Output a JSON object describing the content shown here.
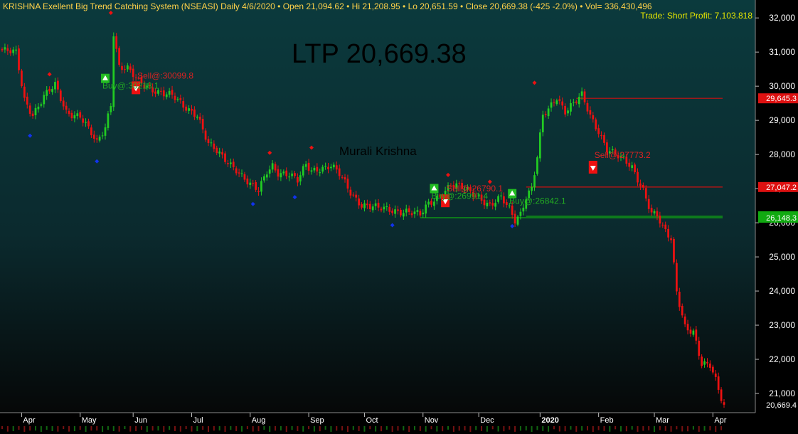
{
  "header": {
    "title_line": "KRISHNA Exellent Big Trend Catching System (NSEASI) Daily  4/6/2020  •  Open 21,094.62  •  Hi 21,208.95  •  Lo 20,651.59  •  Close 20,669.38 (-425 -2.0%)  •  Vol= 336,430,496",
    "trade_status": "Trade: Short Profit: 7,103.818",
    "ltp_label": "LTP 20,669.38",
    "watermark": "Murali Krishna"
  },
  "colors": {
    "bull": "#22cc22",
    "bear": "#ee1111",
    "buy_text": "#22aa22",
    "sell_text": "#dd2222",
    "title_text": "#ffd24a",
    "trade_text": "#e6e600",
    "axis_text": "#ffffff",
    "resist_line": "#cc1111",
    "support_line": "#11aa11",
    "swing_low_dot": "#1133ee",
    "swing_high_dot": "#ee1111"
  },
  "chart_data": {
    "type": "candlestick",
    "symbol": "NSEASI",
    "ylim": [
      20500,
      32400
    ],
    "y_ticks": [
      21000,
      22000,
      23000,
      24000,
      25000,
      26000,
      27000,
      28000,
      29000,
      30000,
      31000,
      32000
    ],
    "y_tick_labels": [
      "21,000",
      "22,000",
      "23,000",
      "24,000",
      "25,000",
      "26,000",
      "27,000",
      "28,000",
      "29,000",
      "30,000",
      "31,000",
      "32,000"
    ],
    "x_labels": [
      "Apr",
      "May",
      "Jun",
      "Jul",
      "Aug",
      "Sep",
      "Oct",
      "Nov",
      "Dec",
      "2020",
      "Feb",
      "Mar",
      "Apr"
    ],
    "x_label_index": [
      7,
      28,
      47,
      68,
      89,
      110,
      130,
      151,
      171,
      193,
      214,
      234,
      255
    ],
    "bar_count": 260,
    "close_anchors": [
      [
        0,
        31050
      ],
      [
        5,
        30950
      ],
      [
        8,
        29600
      ],
      [
        11,
        29200
      ],
      [
        15,
        29700
      ],
      [
        19,
        30000
      ],
      [
        23,
        29250
      ],
      [
        28,
        29150
      ],
      [
        34,
        28300
      ],
      [
        37,
        28800
      ],
      [
        39,
        29500
      ],
      [
        40,
        31600
      ],
      [
        42,
        30600
      ],
      [
        45,
        30500
      ],
      [
        49,
        30100
      ],
      [
        55,
        29900
      ],
      [
        61,
        29700
      ],
      [
        65,
        29400
      ],
      [
        70,
        29200
      ],
      [
        74,
        28300
      ],
      [
        79,
        27900
      ],
      [
        84,
        27600
      ],
      [
        89,
        27100
      ],
      [
        92,
        26900
      ],
      [
        95,
        27500
      ],
      [
        97,
        27700
      ],
      [
        99,
        27500
      ],
      [
        103,
        27400
      ],
      [
        106,
        27200
      ],
      [
        109,
        27700
      ],
      [
        111,
        27550
      ],
      [
        113,
        27600
      ],
      [
        118,
        27650
      ],
      [
        121,
        27400
      ],
      [
        125,
        26900
      ],
      [
        129,
        26550
      ],
      [
        135,
        26400
      ],
      [
        145,
        26350
      ],
      [
        150,
        26200
      ],
      [
        153,
        26550
      ],
      [
        158,
        26900
      ],
      [
        161,
        27100
      ],
      [
        165,
        27000
      ],
      [
        171,
        26800
      ],
      [
        175,
        26500
      ],
      [
        179,
        26700
      ],
      [
        182,
        26400
      ],
      [
        184,
        26100
      ],
      [
        186,
        26300
      ],
      [
        188,
        26800
      ],
      [
        190,
        27000
      ],
      [
        192,
        27900
      ],
      [
        194,
        29100
      ],
      [
        196,
        29300
      ],
      [
        199,
        29700
      ],
      [
        202,
        29300
      ],
      [
        205,
        29500
      ],
      [
        208,
        29700
      ],
      [
        211,
        29100
      ],
      [
        214,
        28700
      ],
      [
        217,
        28200
      ],
      [
        220,
        28000
      ],
      [
        223,
        27800
      ],
      [
        226,
        27600
      ],
      [
        230,
        27000
      ],
      [
        233,
        26300
      ],
      [
        235,
        26200
      ],
      [
        237,
        25800
      ],
      [
        240,
        25500
      ],
      [
        242,
        24000
      ],
      [
        245,
        23000
      ],
      [
        248,
        22800
      ],
      [
        251,
        21800
      ],
      [
        254,
        21800
      ],
      [
        256,
        21400
      ],
      [
        259,
        20669.38
      ]
    ],
    "levels": [
      {
        "label": "29,645.3",
        "value": 29645.3,
        "kind": "resistance",
        "from_index": 206
      },
      {
        "label": "27,047.2",
        "value": 27047.2,
        "kind": "resistance",
        "from_index": 188
      },
      {
        "label": "26,189.8",
        "value": 26189.8,
        "kind": "support",
        "from_index": 188
      },
      {
        "label": "26,148.3",
        "value": 26148.3,
        "kind": "support",
        "from_index": 150
      }
    ],
    "last_price_label": "20,669.4",
    "last_price": 20669.4,
    "signals": [
      {
        "label": "Sell@:30099.8",
        "type": "sell",
        "index": 48,
        "price": 30099.8
      },
      {
        "label": "Buy@:30218.1",
        "type": "buy",
        "index": 37,
        "price": 30218.1
      },
      {
        "label": "Sell@:26790.1",
        "type": "sell",
        "index": 159,
        "price": 26790.1
      },
      {
        "label": "Buy@:26991.4",
        "type": "buy",
        "index": 155,
        "price": 26991.4
      },
      {
        "label": "Buy@:26842.1",
        "type": "buy",
        "index": 183,
        "price": 26842.1
      },
      {
        "label": "Sell@:27773.2",
        "type": "sell",
        "index": 212,
        "price": 27773.2
      }
    ],
    "swing_highs": [
      [
        17,
        30350
      ],
      [
        39,
        32150
      ],
      [
        96,
        28050
      ],
      [
        111,
        28200
      ],
      [
        160,
        27400
      ],
      [
        175,
        27200
      ],
      [
        191,
        30100
      ]
    ],
    "swing_lows": [
      [
        10,
        28550
      ],
      [
        34,
        27800
      ],
      [
        90,
        26550
      ],
      [
        105,
        26750
      ],
      [
        140,
        25930
      ],
      [
        183,
        25900
      ]
    ]
  }
}
